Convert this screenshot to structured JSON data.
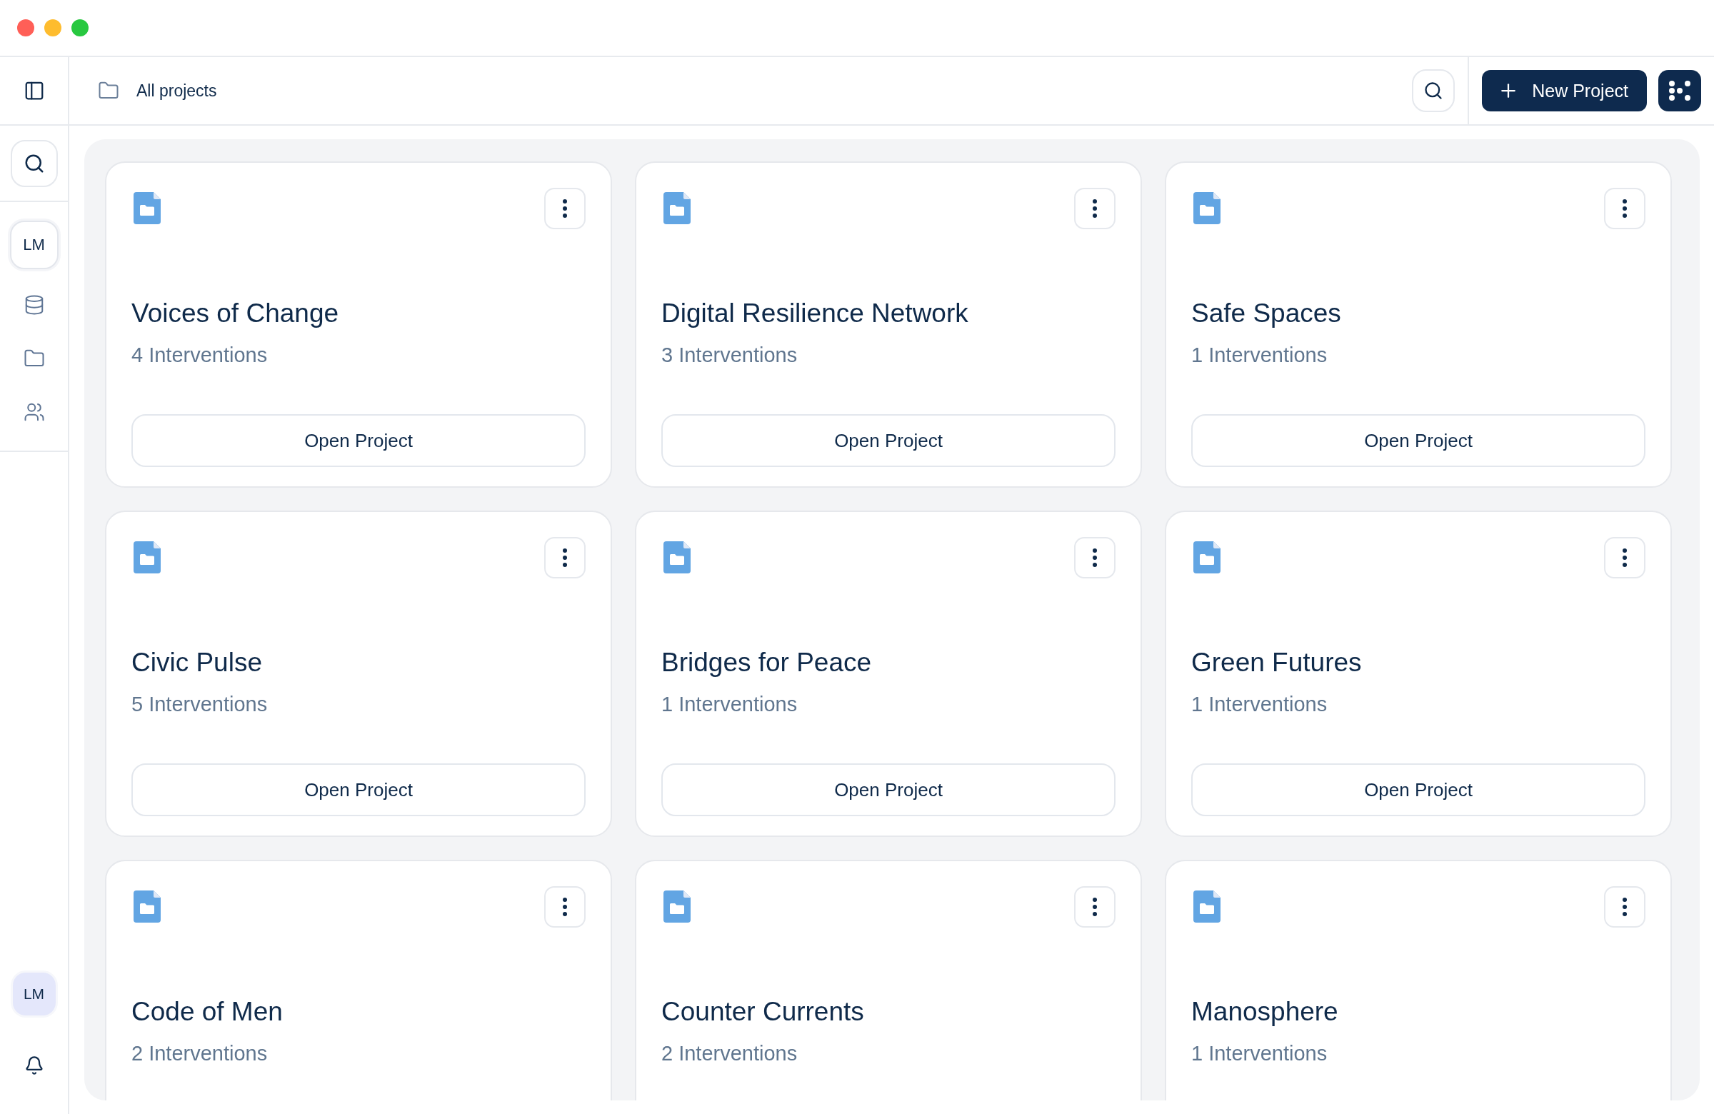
{
  "sidebar": {
    "workspace": "LM",
    "nav_items": [
      {
        "kind": "database"
      },
      {
        "kind": "folder"
      },
      {
        "kind": "users"
      }
    ],
    "user": "LM"
  },
  "header": {
    "breadcrumb": "All projects",
    "new_project_label": "New Project"
  },
  "projects": [
    {
      "name": "Voices of Change",
      "count": "4 Interventions",
      "action": "Open Project"
    },
    {
      "name": "Digital Resilience Network",
      "count": "3 Interventions",
      "action": "Open Project"
    },
    {
      "name": "Safe Spaces",
      "count": "1 Interventions",
      "action": "Open Project"
    },
    {
      "name": "Civic Pulse",
      "count": "5 Interventions",
      "action": "Open Project"
    },
    {
      "name": "Bridges for Peace",
      "count": "1 Interventions",
      "action": "Open Project"
    },
    {
      "name": "Green Futures",
      "count": "1 Interventions",
      "action": "Open Project"
    },
    {
      "name": "Code of Men",
      "count": "2 Interventions"
    },
    {
      "name": "Counter Currents",
      "count": "2 Interventions"
    },
    {
      "name": "Manosphere",
      "count": "1 Interventions"
    }
  ]
}
